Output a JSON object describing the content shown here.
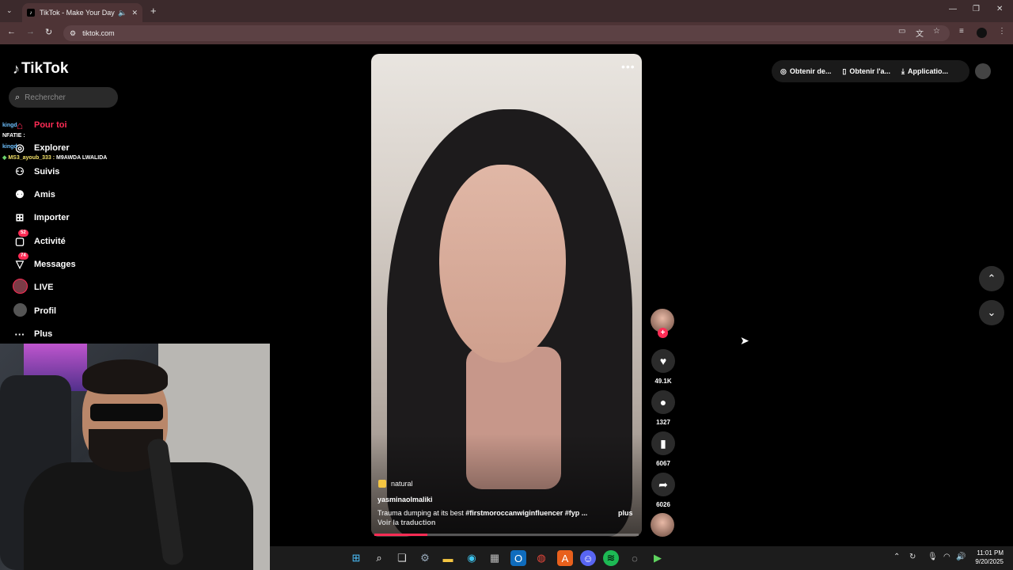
{
  "browser": {
    "tab_title": "TikTok - Make Your Day",
    "url": "tiktok.com",
    "icons": [
      "back-icon",
      "forward-icon",
      "reload-icon",
      "cast-icon",
      "translate-icon",
      "star-icon",
      "extensions-icon",
      "menu-icon"
    ]
  },
  "sidebar": {
    "logo": "TikTok",
    "search_placeholder": "Rechercher",
    "items": [
      {
        "label": "Pour toi",
        "icon": "home-icon"
      },
      {
        "label": "Explorer",
        "icon": "compass-icon"
      },
      {
        "label": "Suivis",
        "icon": "following-icon"
      },
      {
        "label": "Amis",
        "icon": "friends-icon"
      },
      {
        "label": "Importer",
        "icon": "upload-icon"
      },
      {
        "label": "Activité",
        "icon": "activity-icon",
        "badge": "52"
      },
      {
        "label": "Messages",
        "icon": "messages-icon",
        "badge": "74"
      },
      {
        "label": "LIVE",
        "icon": "live-icon"
      },
      {
        "label": "Profil",
        "icon": "profile-icon"
      },
      {
        "label": "Plus",
        "icon": "more-icon"
      }
    ]
  },
  "chat_overlay": [
    {
      "user": "kingd",
      "msg": ""
    },
    {
      "user": "NFATIE :",
      "msg": ""
    },
    {
      "user": "kingd",
      "msg": ""
    },
    {
      "user": "MS3_ayoub_333 :",
      "msg": "M9AWDA LWALIDA"
    }
  ],
  "video": {
    "tag": "natural",
    "username": "yasminaolmaliki",
    "description_text": "Trauma dumping at its best ",
    "hashtags": "#firstmoroccanwiginfluencer #fyp ...",
    "more": "plus",
    "translate": "Voir la traduction",
    "progress": 0.2
  },
  "actions": {
    "likes": "49.1K",
    "comments": "1327",
    "saves": "6067",
    "shares": "6026"
  },
  "top_right": {
    "item1": "Obtenir de...",
    "item2": "Obtenir l'a...",
    "item3": "Applicatio..."
  },
  "taskbar": {
    "time": "11:01 PM",
    "date": "9/20/2025"
  },
  "colors": {
    "accent": "#fe2c55",
    "chrome": "#3c2a2c",
    "background": "#000000"
  }
}
